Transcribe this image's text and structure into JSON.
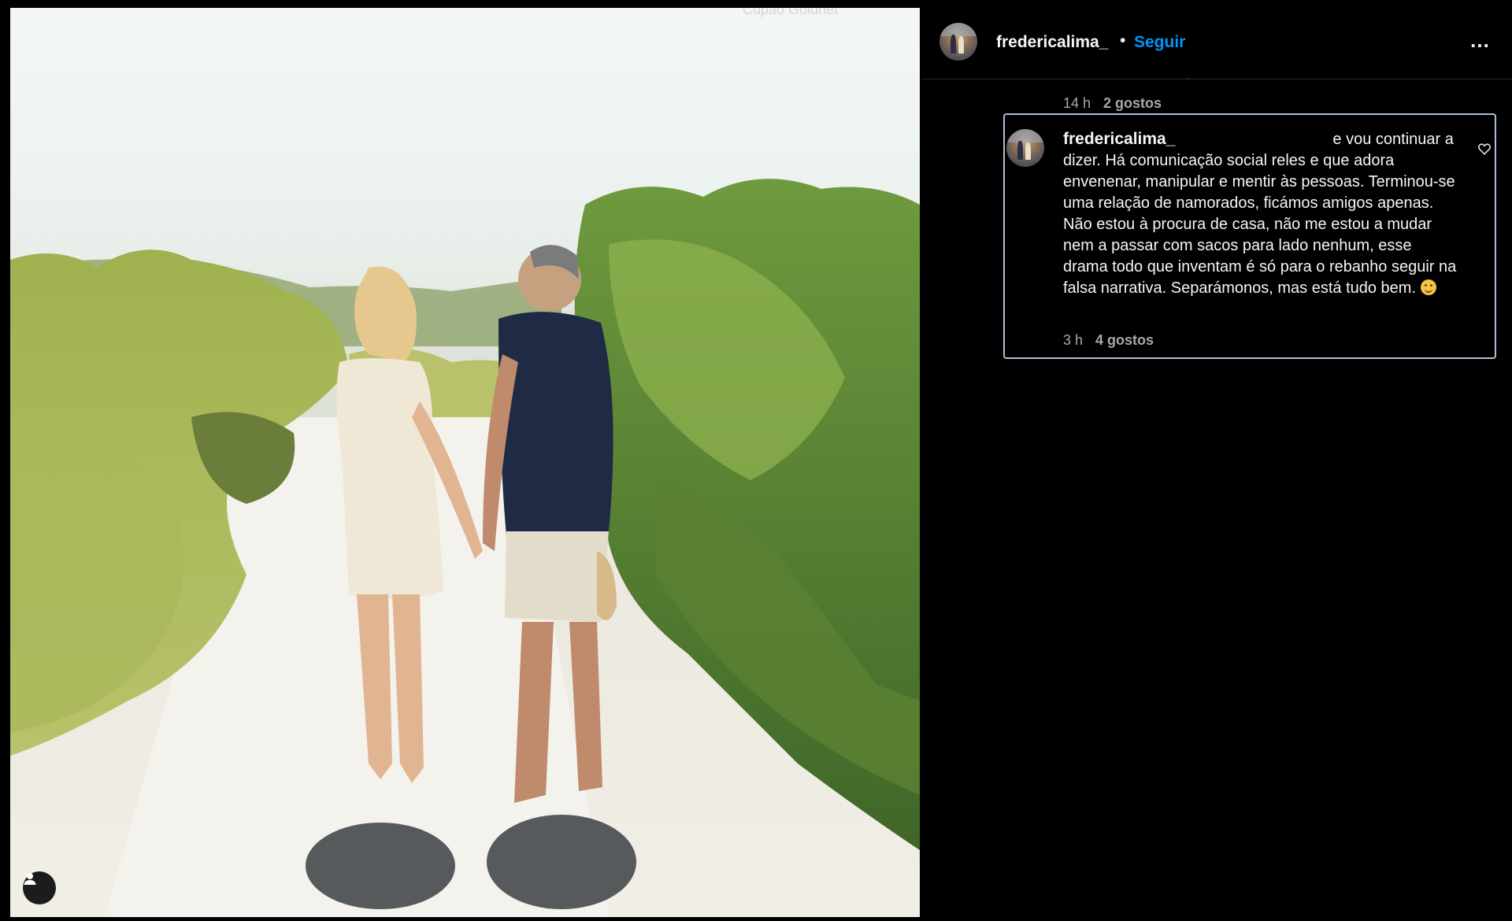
{
  "watermark": "Cupão Goldnet",
  "post": {
    "username": "fredericalima_",
    "separator": "•",
    "follow_label": "Seguir",
    "more_icon": "…"
  },
  "previous_comment": {
    "time": "14 h",
    "likes": "2 gostos"
  },
  "comment": {
    "username": "fredericalima_",
    "line1_tail": "e vou continuar",
    "body": "a dizer. Há comunicação social reles e que adora envenenar, manipular e mentir às pessoas. Terminou-se uma relação de namorados, ficámos amigos apenas. Não estou à procura de casa, não me estou a mudar nem a passar com sacos para lado nenhum, esse drama todo que inventam é só para o rebanho seguir na falsa narrativa. Separámonos, mas está tudo bem.",
    "emoji": "smiling-face-emoji",
    "time": "3 h",
    "likes": "4 gostos"
  },
  "colors": {
    "follow": "#0095f6",
    "highlight_border": "#aebfd4",
    "background": "#000000"
  }
}
